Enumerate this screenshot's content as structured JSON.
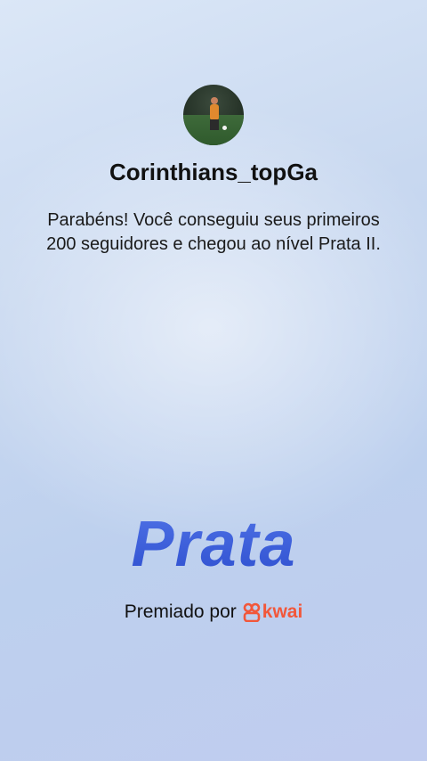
{
  "profile": {
    "username": "Corinthians_topGa"
  },
  "message": {
    "text": "Parabéns! Você conseguiu seus primeiros 200 seguidores e chegou ao nível Prata II."
  },
  "level": {
    "title": "Prata"
  },
  "award": {
    "prefix": "Premiado por",
    "brand": "kwai",
    "brand_color": "#f2573a"
  }
}
